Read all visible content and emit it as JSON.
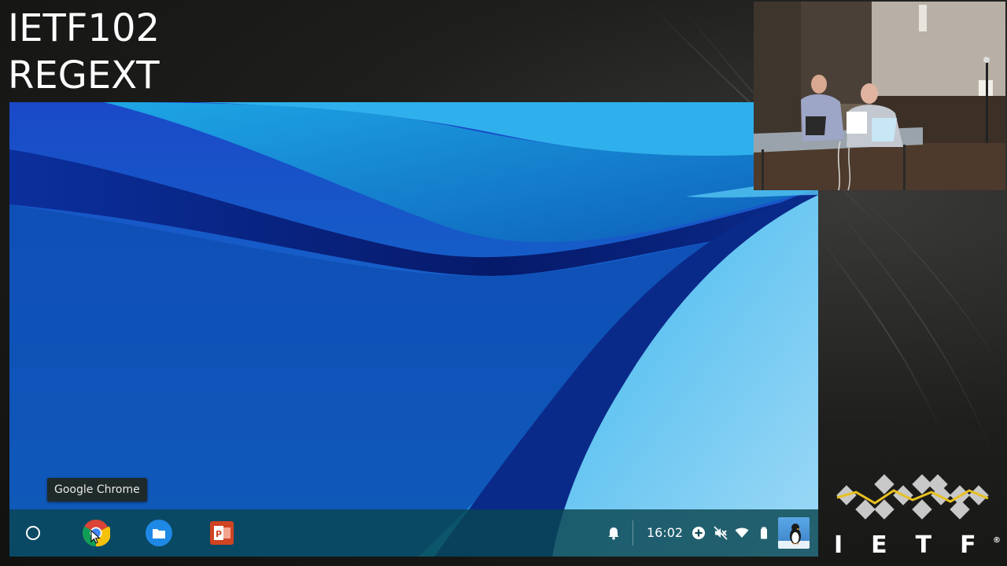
{
  "session": {
    "line1": "IETF102",
    "line2": "REGEXT"
  },
  "chromeos": {
    "tooltip": "Google Chrome",
    "shelf": {
      "apps": [
        {
          "name": "launcher",
          "icon": "launcher-circle-icon"
        },
        {
          "name": "Google Chrome",
          "icon": "chrome-icon"
        },
        {
          "name": "Files",
          "icon": "files-icon"
        },
        {
          "name": "Slides",
          "icon": "powerpoint-icon"
        }
      ]
    },
    "status": {
      "time": "16:02",
      "icons": [
        "notification-bell-icon",
        "add-circle-icon",
        "volume-muted-icon",
        "wifi-icon",
        "battery-icon",
        "user-avatar-icon"
      ]
    }
  },
  "logo": {
    "text": "IETF",
    "trademark": "®"
  },
  "colors": {
    "shelf": "#0a4650",
    "wallpaper_dark": "#0a2a8a",
    "wallpaper_light": "#5fc7f0",
    "logo_gold": "#e8c020",
    "logo_gray": "#c8c8c8"
  }
}
